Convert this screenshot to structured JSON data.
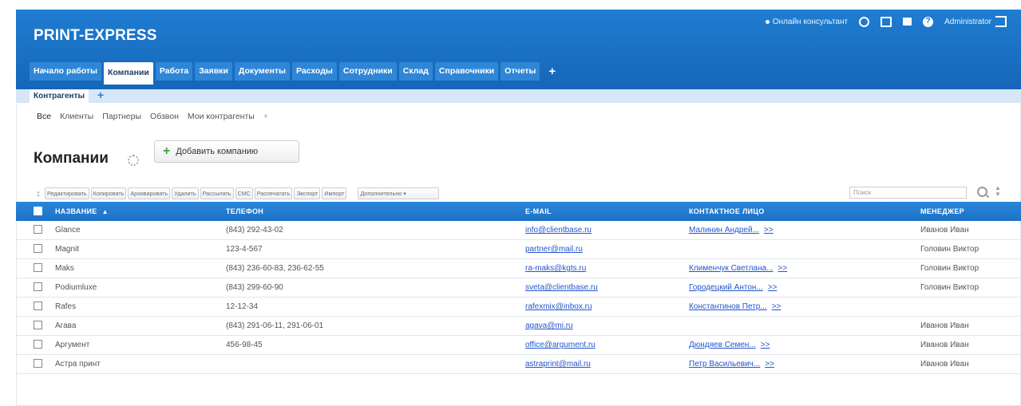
{
  "app": {
    "brand": "PRINT-EXPRESS",
    "online_label": "Онлайн консультант",
    "user_label": "Administrator"
  },
  "tabs": [
    {
      "label": "Начало работы",
      "active": false
    },
    {
      "label": "Компании",
      "active": true
    },
    {
      "label": "Работа",
      "active": false
    },
    {
      "label": "Заявки",
      "active": false
    },
    {
      "label": "Документы",
      "active": false
    },
    {
      "label": "Расходы",
      "active": false
    },
    {
      "label": "Сотрудники",
      "active": false
    },
    {
      "label": "Склад",
      "active": false
    },
    {
      "label": "Справочники",
      "active": false
    },
    {
      "label": "Отчеты",
      "active": false
    }
  ],
  "tab_plus": "+",
  "subtab": {
    "label": "Контрагенты",
    "plus": "+"
  },
  "filters": [
    "Все",
    "Клиенты",
    "Партнеры",
    "Обзвон",
    "Мои контрагенты",
    "+"
  ],
  "page": {
    "title": "Компании",
    "add_button": "Добавить компанию"
  },
  "toolbar": {
    "buttons": [
      "Редактировать",
      "Копировать",
      "Архивировать",
      "Удалить",
      "Рассылать",
      "СМС",
      "Распечатать",
      "Экспорт",
      "Импорт"
    ],
    "more": "Дополнительно ▾"
  },
  "search": {
    "placeholder": "Поиск"
  },
  "table": {
    "columns": [
      "Название",
      "Телефон",
      "E-mail",
      "Контактное лицо",
      "Менеджер"
    ],
    "more_label": ">>",
    "rows": [
      {
        "name": "Glance",
        "phone": "(843) 292-43-02",
        "email": "info@clientbase.ru",
        "contact": "Малинин Андрей...",
        "manager": "Иванов Иван"
      },
      {
        "name": "Magnit",
        "phone": "123-4-567",
        "email": "partner@mail.ru",
        "contact": "",
        "manager": "Головин Виктор"
      },
      {
        "name": "Maks",
        "phone": "(843) 236-60-83, 236-62-55",
        "email": "ra-maks@kgts.ru",
        "contact": "Клименчук Светлана...",
        "manager": "Головин Виктор"
      },
      {
        "name": "Podiumluxe",
        "phone": "(843) 299-60-90",
        "email": "sveta@clientbase.ru",
        "contact": "Городецкий Антон...",
        "manager": "Головин Виктор"
      },
      {
        "name": "Rafes",
        "phone": "12-12-34",
        "email": "rafexmix@inbox.ru",
        "contact": "Константинов Петр...",
        "manager": ""
      },
      {
        "name": "Агава",
        "phone": "(843) 291-06-11, 291-06-01",
        "email": "agava@mi.ru",
        "contact": "",
        "manager": "Иванов Иван"
      },
      {
        "name": "Аргумент",
        "phone": "456-98-45",
        "email": "office@argument.ru",
        "contact": "Дюндяев Семен...",
        "manager": "Иванов Иван"
      },
      {
        "name": "Астра принт",
        "phone": "",
        "email": "astraprint@mail.ru",
        "contact": "Петр Васильевич...",
        "manager": "Иванов Иван"
      }
    ]
  }
}
